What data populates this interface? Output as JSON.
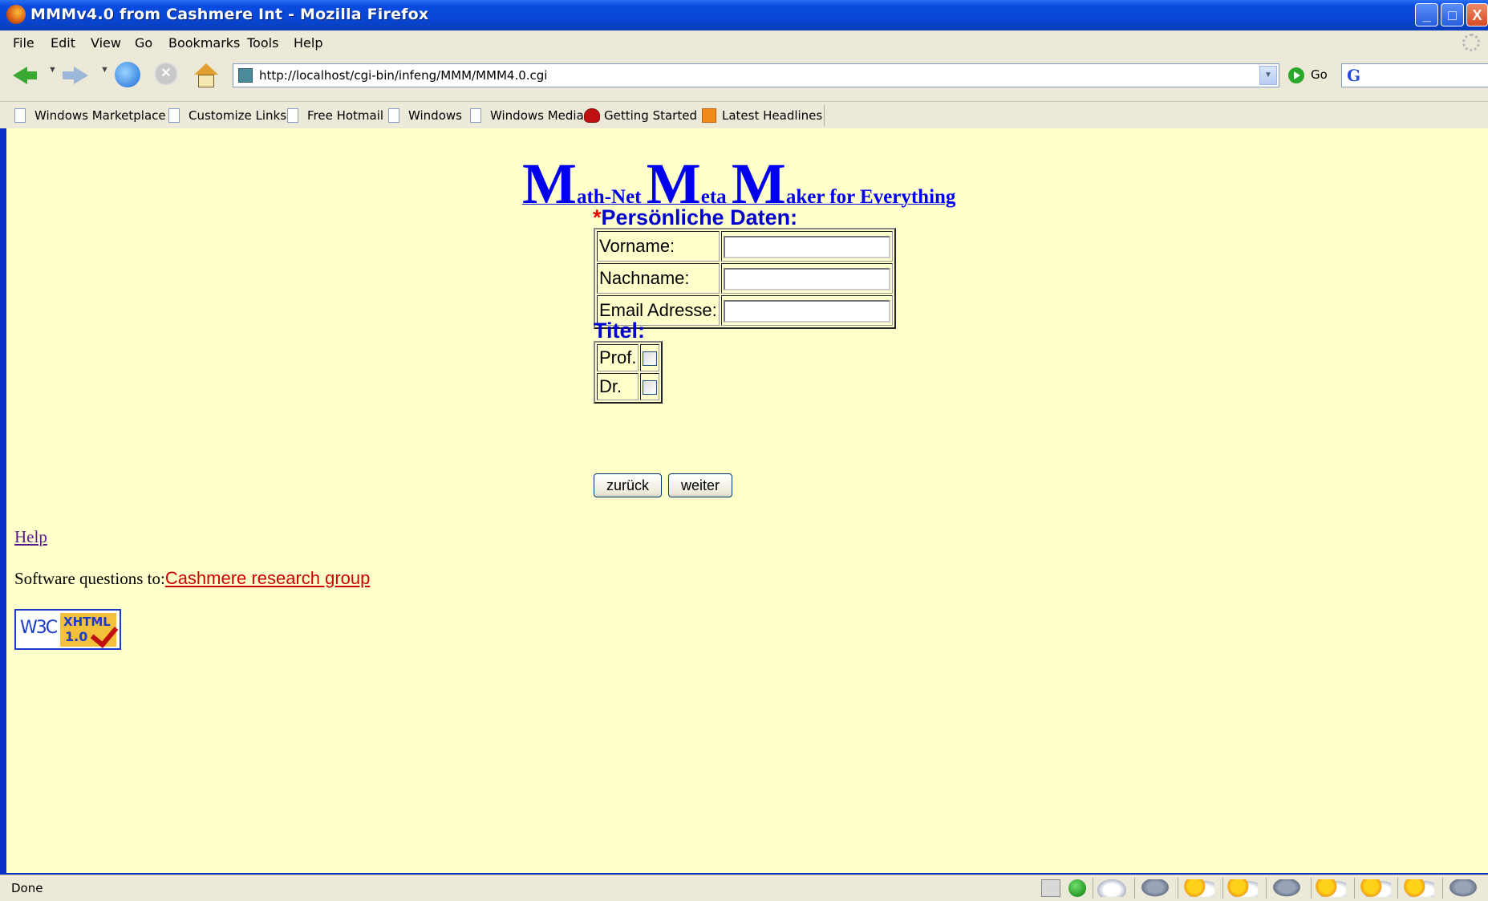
{
  "window": {
    "title": "MMMv4.0 from Cashmere Int - Mozilla Firefox",
    "controls": {
      "minimize": "_",
      "maximize": "□",
      "close": "X"
    }
  },
  "menu": [
    "File",
    "Edit",
    "View",
    "Go",
    "Bookmarks",
    "Tools",
    "Help"
  ],
  "toolbar": {
    "url": "http://localhost/cgi-bin/infeng/MMM/MMM4.0.cgi",
    "go_label": "Go",
    "search_icon": "google-search-icon",
    "stop_glyph": "✕"
  },
  "bookmarks": [
    {
      "label": "Windows Marketplace",
      "icon": "page-icon"
    },
    {
      "label": "Customize Links",
      "icon": "page-icon"
    },
    {
      "label": "Free Hotmail",
      "icon": "page-icon"
    },
    {
      "label": "Windows",
      "icon": "page-icon"
    },
    {
      "label": "Windows Media",
      "icon": "page-icon"
    },
    {
      "label": "Getting Started",
      "icon": "firefox-icon"
    },
    {
      "label": "Latest Headlines",
      "icon": "rss-icon"
    }
  ],
  "page": {
    "title_parts": [
      {
        "big": "M",
        "small": "ath-Net "
      },
      {
        "big": "M",
        "small": "eta "
      },
      {
        "big": "M",
        "small": "aker for Everything"
      }
    ],
    "required_mark": "*",
    "personal_heading": "Persönliche Daten:",
    "fields": {
      "first_name": {
        "label": "Vorname:",
        "value": ""
      },
      "last_name": {
        "label": "Nachname:",
        "value": ""
      },
      "email": {
        "label": "Email Adresse:",
        "value": ""
      }
    },
    "title_heading": "Titel:",
    "titles": {
      "prof": "Prof.",
      "dr": "Dr."
    },
    "buttons": {
      "back": "zurück",
      "next": "weiter"
    },
    "help_link": "Help",
    "questions_text": "Software questions to:",
    "questions_link": "Cashmere research group",
    "badge": {
      "left": "W3C",
      "top": "XHTML",
      "bottom": "1.0"
    }
  },
  "status": {
    "text": "Done",
    "icons": [
      "grid-icon",
      "green-dot-icon",
      "cloud-icon",
      "rain-icon",
      "sun-cloud-icon",
      "sun-cloud-icon",
      "rain-icon",
      "sun-cloud-icon",
      "sun-cloud-icon",
      "sun-cloud-icon",
      "rain-icon"
    ]
  },
  "colors": {
    "page_background": "#ffffcc",
    "heading_blue": "#0000cc",
    "link_blue": "#0000ee",
    "link_red": "#cc0000",
    "required_red": "#ee0000",
    "chrome": "#ece9d8"
  }
}
